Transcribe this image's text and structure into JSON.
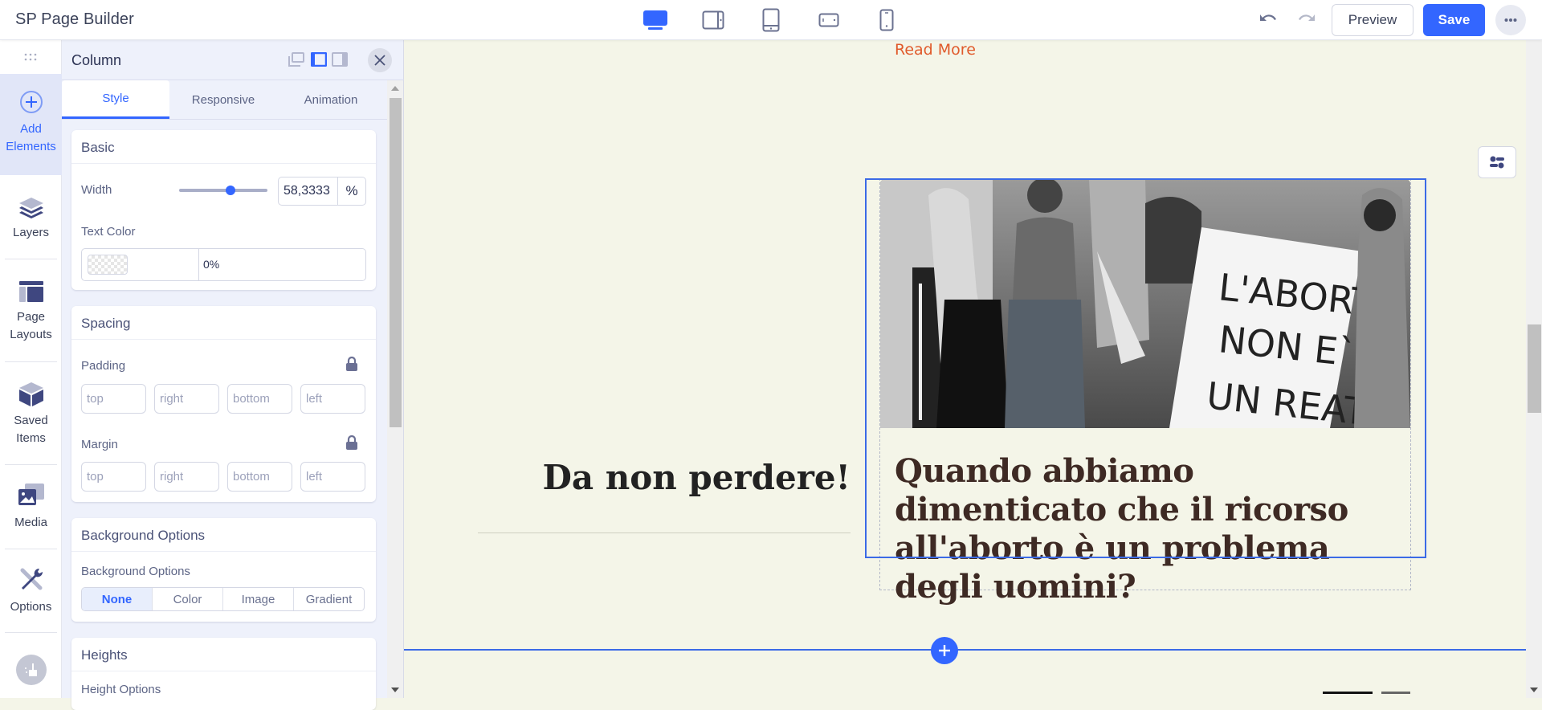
{
  "app": {
    "title": "SP Page Builder"
  },
  "devices": [
    {
      "name": "desktop",
      "active": true
    },
    {
      "name": "tablet-landscape",
      "active": false
    },
    {
      "name": "tablet",
      "active": false
    },
    {
      "name": "mobile-landscape",
      "active": false
    },
    {
      "name": "mobile",
      "active": false
    }
  ],
  "toolbar": {
    "preview_label": "Preview",
    "save_label": "Save"
  },
  "rail": {
    "items": [
      {
        "label": "Add Elements",
        "icon": "plus-circle-icon",
        "active": true
      },
      {
        "label": "Layers",
        "icon": "layers-icon"
      },
      {
        "label": "Page Layouts",
        "icon": "page-layouts-icon"
      },
      {
        "label": "Saved Items",
        "icon": "box-icon"
      },
      {
        "label": "Media",
        "icon": "media-icon"
      },
      {
        "label": "Options",
        "icon": "tools-icon"
      }
    ],
    "clean_icon": "broom-icon"
  },
  "panel": {
    "title": "Column",
    "tabs": [
      {
        "label": "Style",
        "active": true
      },
      {
        "label": "Responsive"
      },
      {
        "label": "Animation"
      }
    ],
    "basic": {
      "title": "Basic",
      "width_label": "Width",
      "width_value": "58,3333",
      "width_unit": "%",
      "width_slider_fraction": 0.58,
      "text_color_label": "Text Color",
      "text_color_opacity": "0%"
    },
    "spacing": {
      "title": "Spacing",
      "padding_label": "Padding",
      "margin_label": "Margin",
      "placeholders": {
        "top": "top",
        "right": "right",
        "bottom": "bottom",
        "left": "left"
      }
    },
    "background": {
      "title": "Background Options",
      "sub_label": "Background Options",
      "options": [
        "None",
        "Color",
        "Image",
        "Gradient"
      ],
      "selected": "None"
    },
    "heights": {
      "title": "Heights",
      "sub_label": "Height Options"
    }
  },
  "canvas": {
    "read_more": "Read More",
    "section_heading": "Da non perdere!",
    "article_title": "Quando abbiamo dimenticato che il ricorso all'aborto è un problema degli uomini?",
    "image_sign_text": [
      "L'ABORTO",
      "NON E`",
      "UN REATO"
    ],
    "colors": {
      "accent": "#3366ff",
      "link": "#e05a2b",
      "background": "#f4f5e8"
    }
  }
}
